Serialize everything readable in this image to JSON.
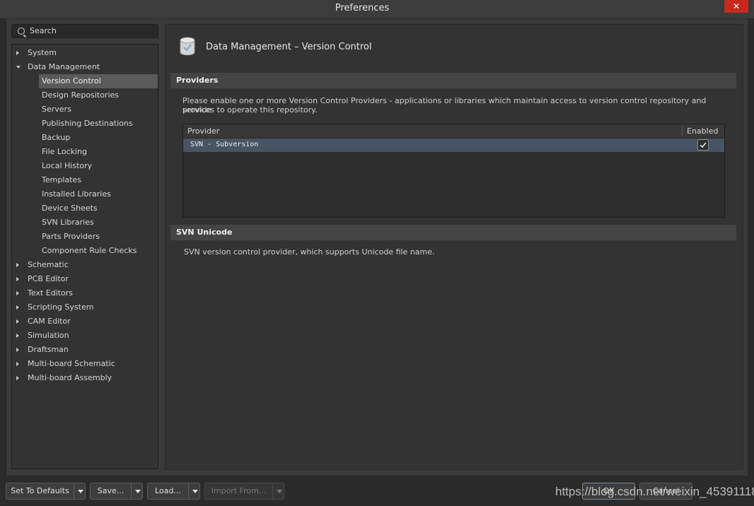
{
  "window": {
    "title": "Preferences",
    "close_label": "✕"
  },
  "search": {
    "placeholder": "Search"
  },
  "tree": {
    "items": [
      {
        "label": "System",
        "expanded": false
      },
      {
        "label": "Data Management",
        "expanded": true,
        "children": [
          "Version Control",
          "Design Repositories",
          "Servers",
          "Publishing Destinations",
          "Backup",
          "File Locking",
          "Local History",
          "Templates",
          "Installed Libraries",
          "Device Sheets",
          "SVN Libraries",
          "Parts Providers",
          "Component Rule Checks"
        ]
      },
      {
        "label": "Schematic"
      },
      {
        "label": "PCB Editor"
      },
      {
        "label": "Text Editors"
      },
      {
        "label": "Scripting System"
      },
      {
        "label": "CAM Editor"
      },
      {
        "label": "Simulation"
      },
      {
        "label": "Draftsman"
      },
      {
        "label": "Multi-board Schematic"
      },
      {
        "label": "Multi-board Assembly"
      }
    ]
  },
  "page": {
    "title": "Data Management – Version Control",
    "providers_section": "Providers",
    "providers_desc_line1": "Please enable one or more Version Control Providers - applications or libraries which maintain access to version control repository and provide",
    "providers_desc_line2": "services to  operate this repository.",
    "grid": {
      "col_provider": "Provider",
      "col_enabled": "Enabled",
      "rows": [
        {
          "provider": "SVN - Subversion",
          "enabled": true
        }
      ]
    },
    "svn_section": "SVN Unicode",
    "svn_desc": "SVN version control provider, which supports Unicode file name."
  },
  "footer": {
    "set_defaults": "Set To Defaults",
    "save": "Save...",
    "load": "Load...",
    "import_from": "Import From...",
    "ok": "OK",
    "cancel": "Cancel"
  },
  "watermark": "https://blog.csdn.net/weixin_45391118",
  "colors": {
    "accent_selected": "#5a5a5a",
    "grid_row_selected": "#465463",
    "close_red": "#c42b1c"
  },
  "icons": [
    "search-icon",
    "version-control-icon",
    "checkmark-icon",
    "expand-triangle-icon",
    "collapse-triangle-icon",
    "dropdown-arrow-icon",
    "close-icon"
  ]
}
